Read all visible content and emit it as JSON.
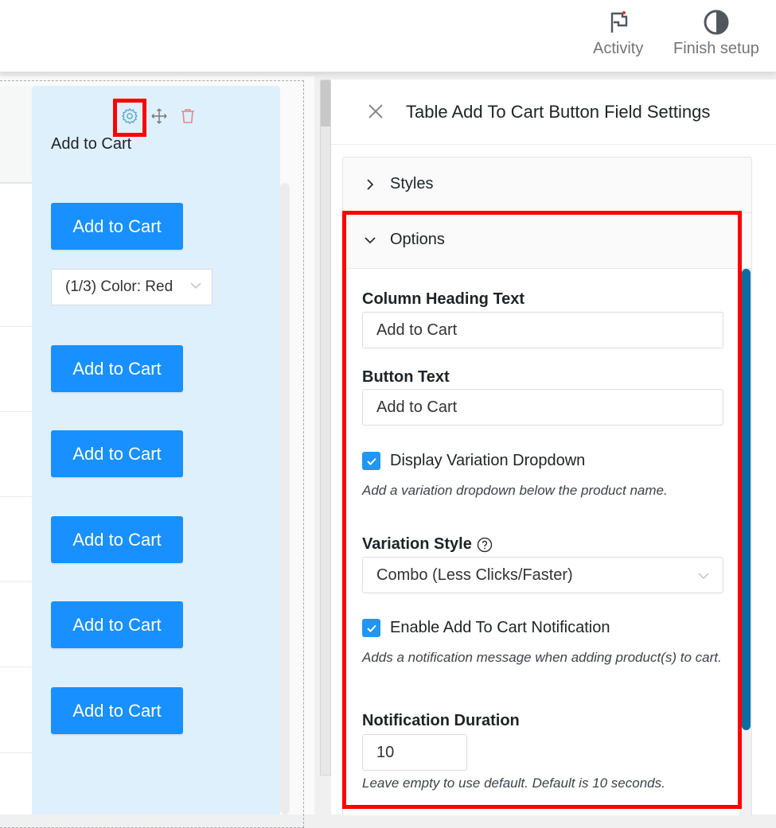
{
  "topbar": {
    "actions": [
      {
        "label": "Activity",
        "icon": "flag-icon"
      },
      {
        "label": "Finish setup",
        "icon": "half-circle-icon"
      }
    ]
  },
  "column": {
    "tools": [
      "gear-icon",
      "move-icon",
      "trash-icon"
    ],
    "heading": "Add to Cart",
    "buttons": [
      "Add to Cart",
      "Add to Cart",
      "Add to Cart",
      "Add to Cart",
      "Add to Cart",
      "Add to Cart"
    ],
    "variation_select": "(1/3) Color: Red"
  },
  "panel": {
    "title": "Table Add To Cart Button Field Settings",
    "sections": [
      {
        "label": "Styles",
        "expanded": false
      },
      {
        "label": "Options",
        "expanded": true
      }
    ],
    "options": {
      "column_heading": {
        "label": "Column Heading Text",
        "value": "Add to Cart"
      },
      "button_text": {
        "label": "Button Text",
        "value": "Add to Cart"
      },
      "display_variation": {
        "label": "Display Variation Dropdown",
        "checked": true,
        "help": "Add a variation dropdown below the product name."
      },
      "variation_style": {
        "label": "Variation Style",
        "value": "Combo (Less Clicks/Faster)"
      },
      "enable_notification": {
        "label": "Enable Add To Cart Notification",
        "checked": true,
        "help": "Adds a notification message when adding product(s) to cart."
      },
      "notification_duration": {
        "label": "Notification Duration",
        "value": "10",
        "help": "Leave empty to use default. Default is 10 seconds."
      }
    }
  },
  "colors": {
    "primary_button": "#1890ff",
    "checkbox": "#2196f3",
    "highlight": "#ff0000",
    "scrollbar": "#0a6ea3",
    "column_bg": "#dff0fd"
  }
}
